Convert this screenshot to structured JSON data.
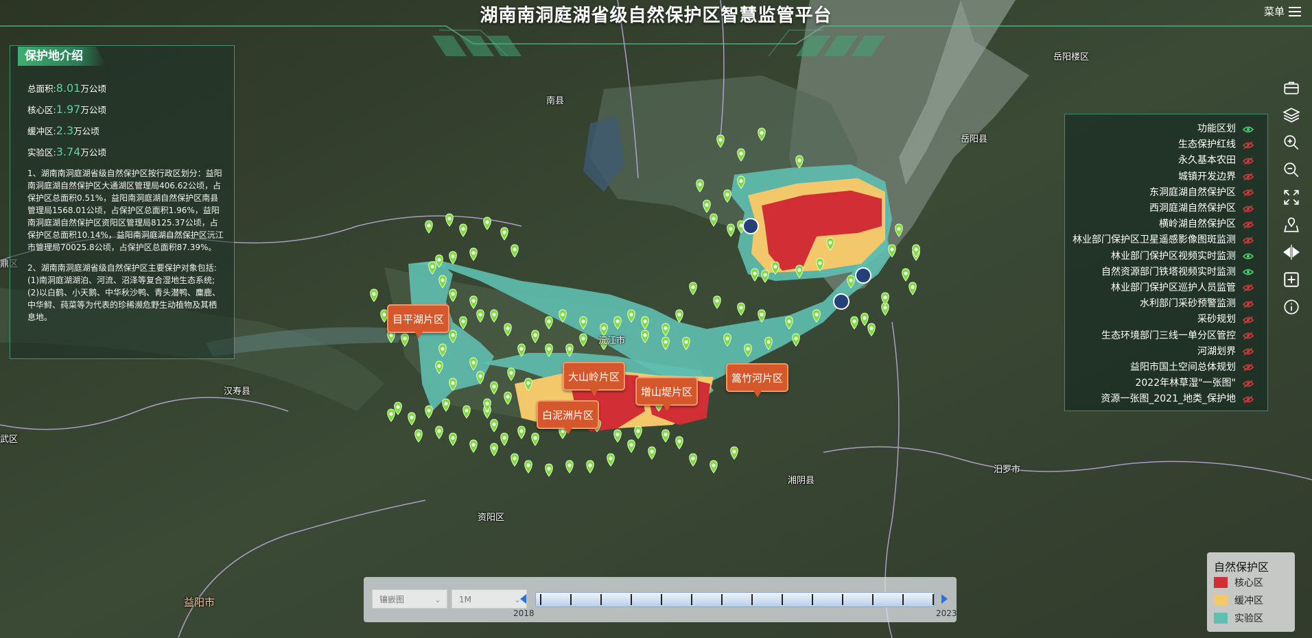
{
  "header": {
    "title": "湖南南洞庭湖省级自然保护区智慧监管平台",
    "menu_label": "菜单"
  },
  "intro": {
    "tab_label": "保护地介绍",
    "stats": [
      {
        "label": "总面积:",
        "value": "8.01",
        "unit": "万公顷"
      },
      {
        "label": "核心区:",
        "value": "1.97",
        "unit": "万公顷"
      },
      {
        "label": "缓冲区:",
        "value": "2.3",
        "unit": "万公顷"
      },
      {
        "label": "实验区:",
        "value": "3.74",
        "unit": "万公顷"
      }
    ],
    "paragraph_1": "1、湖南南洞庭湖省级自然保护区按行政区划分：益阳南洞庭湖自然保护区大通湖区管理局406.62公顷，占保护区总面积0.51%，益阳南洞庭湖自然保护区南县管理局1568.01公顷，占保护区总面积1.96%，益阳南洞庭湖自然保护区资阳区管理局8125.37公顷，占保护区总面积10.14%，益阳南洞庭湖自然保护区沅江市管理局70025.8公顷，占保护区总面积87.39%。",
    "paragraph_2": "2、湖南南洞庭湖省级自然保护区主要保护对象包括: (1)南洞庭湖湖泊、河流、沼泽等复合湿地生态系统; (2)以白鹤、小天鹅、中华秋沙鸭、青头潜鸭、麋鹿、中华鲟、莼菜等为代表的珍稀濒危野生动植物及其栖息地。"
  },
  "toolbar": [
    "toolbox-icon",
    "layers-icon",
    "zoom-in-icon",
    "zoom-out-icon",
    "fullscreen-icon",
    "locate-icon",
    "split-compare-icon",
    "add-icon",
    "info-icon"
  ],
  "layers": [
    {
      "label": "功能区划",
      "visible": true
    },
    {
      "label": "生态保护红线",
      "visible": false
    },
    {
      "label": "永久基本农田",
      "visible": false
    },
    {
      "label": "城镇开发边界",
      "visible": false
    },
    {
      "label": "东洞庭湖自然保护区",
      "visible": false
    },
    {
      "label": "西洞庭湖自然保护区",
      "visible": false
    },
    {
      "label": "横岭湖自然保护区",
      "visible": false
    },
    {
      "label": "林业部门保护区卫星遥感影像图斑监测",
      "visible": false
    },
    {
      "label": "林业部门保护区视频实时监测",
      "visible": true
    },
    {
      "label": "自然资源部门铁塔视频实时监测",
      "visible": true
    },
    {
      "label": "林业部门保护区巡护人员监管",
      "visible": false
    },
    {
      "label": "水利部门采砂预警监测",
      "visible": false
    },
    {
      "label": "采砂规划",
      "visible": false
    },
    {
      "label": "生态环境部门三线一单分区管控",
      "visible": false
    },
    {
      "label": "河湖划界",
      "visible": false
    },
    {
      "label": "益阳市国土空间总体规划",
      "visible": false
    },
    {
      "label": "2022年林草湿\"一张图\"",
      "visible": false
    },
    {
      "label": "资源一张图_2021_地类_保护地",
      "visible": false
    }
  ],
  "legend": {
    "title": "自然保护区",
    "items": [
      {
        "label": "核心区",
        "color": "#d12f35"
      },
      {
        "label": "缓冲区",
        "color": "#f2c86b"
      },
      {
        "label": "实验区",
        "color": "#5fbfb0"
      }
    ]
  },
  "timeline": {
    "basemap_select": "镶嵌图",
    "scale_select": "1M",
    "start_year": "2018",
    "end_year": "2023"
  },
  "places": [
    "岳阳楼区",
    "南县",
    "岳阳县",
    "沅江市",
    "汉寿县",
    "湘阴县",
    "汨罗市",
    "资阳区",
    "益阳市",
    "武区",
    "鼎区"
  ],
  "zones": [
    "目平湖片区",
    "大山岭片区",
    "增山堤片区",
    "白泥洲片区",
    "篙竹河片区"
  ],
  "colors": {
    "accent": "#5fd1a0",
    "core": "#d12f35",
    "buffer": "#f2c86b",
    "experimental": "#5fbfb0",
    "marker": "#7bdc3a"
  }
}
